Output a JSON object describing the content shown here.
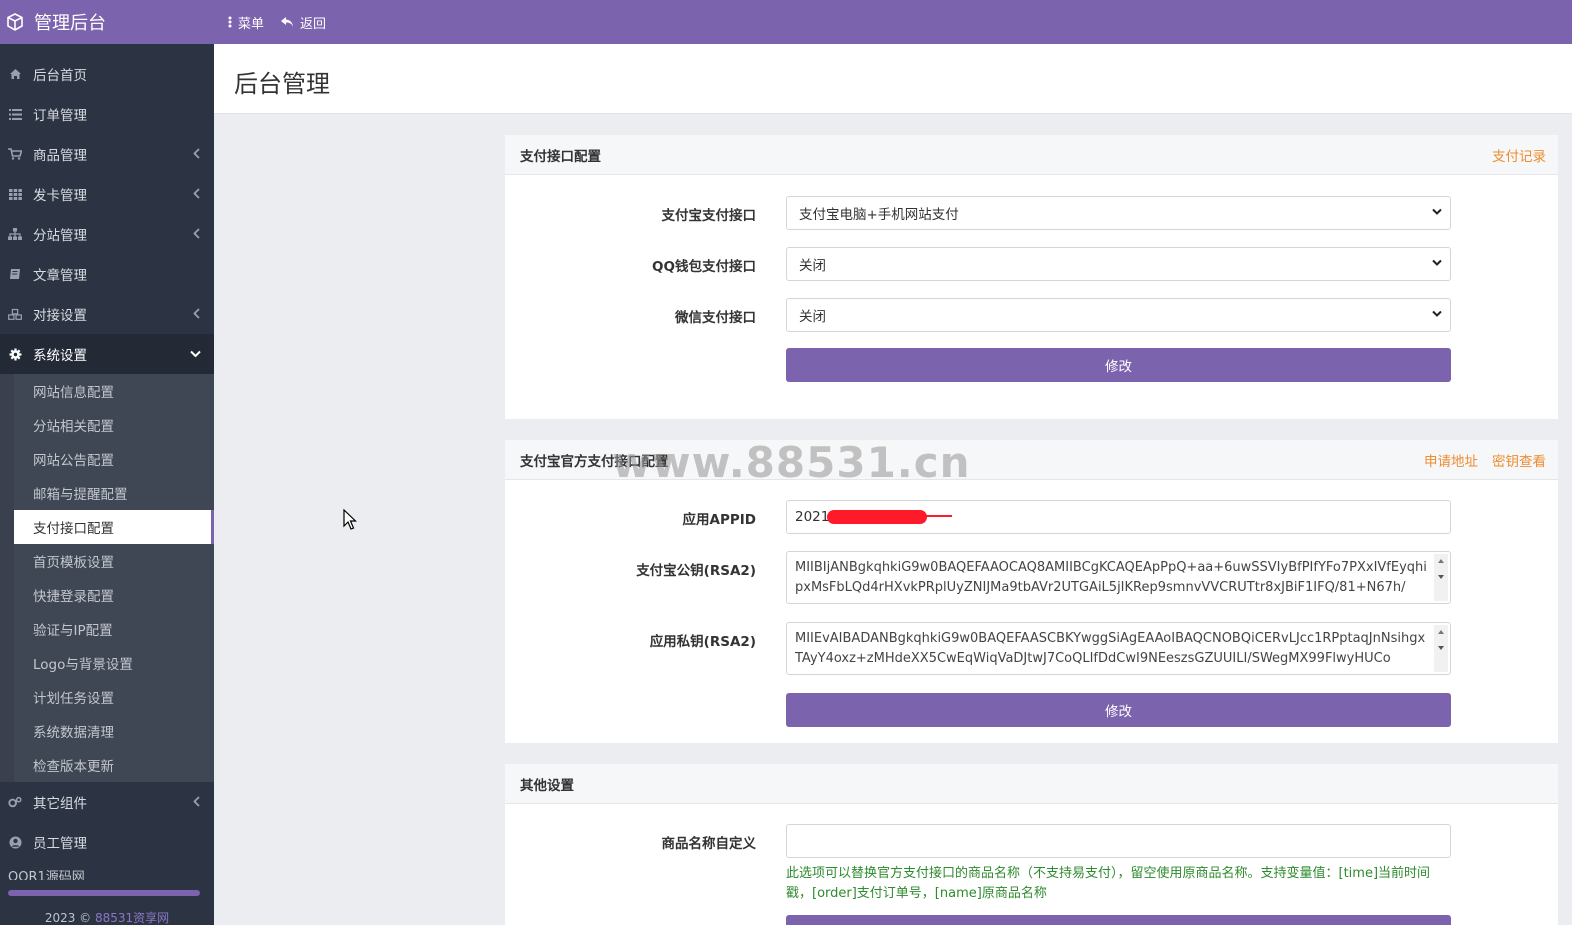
{
  "app": {
    "title": "管理后台"
  },
  "topnav": {
    "menu": "菜单",
    "back": "返回"
  },
  "sidebar": {
    "items": [
      {
        "label": "后台首页",
        "icon": "home-icon"
      },
      {
        "label": "订单管理",
        "icon": "list-icon"
      },
      {
        "label": "商品管理",
        "icon": "cart-icon",
        "has_children": true
      },
      {
        "label": "发卡管理",
        "icon": "grid-icon",
        "has_children": true
      },
      {
        "label": "分站管理",
        "icon": "sitemap-icon",
        "has_children": true
      },
      {
        "label": "文章管理",
        "icon": "book-icon"
      },
      {
        "label": "对接设置",
        "icon": "cubes-icon",
        "has_children": true
      },
      {
        "label": "系统设置",
        "icon": "gear-icon",
        "expanded": true
      }
    ],
    "sub_items": [
      "网站信息配置",
      "分站相关配置",
      "网站公告配置",
      "邮箱与提醒配置",
      "支付接口配置",
      "首页模板设置",
      "快捷登录配置",
      "验证与IP配置",
      "Logo与背景设置",
      "计划任务设置",
      "系统数据清理",
      "检查版本更新"
    ],
    "current_sub": "支付接口配置",
    "bottom_items": [
      {
        "label": "其它组件",
        "icon": "gears-icon",
        "has_children": true
      },
      {
        "label": "员工管理",
        "icon": "user-circle-icon"
      }
    ],
    "footer_partial": "QQR1源码网",
    "copyright_year": "2023 ©",
    "copyright_link": "88531资享网"
  },
  "page": {
    "title": "后台管理"
  },
  "panel_payment": {
    "title": "支付接口配置",
    "link": "支付记录",
    "fields": [
      {
        "label": "支付宝支付接口",
        "value": "支付宝电脑+手机网站支付"
      },
      {
        "label": "QQ钱包支付接口",
        "value": "关闭"
      },
      {
        "label": "微信支付接口",
        "value": "关闭"
      }
    ],
    "submit": "修改"
  },
  "panel_alipay": {
    "title": "支付宝官方支付接口配置",
    "links": [
      "申请地址",
      "密钥查看"
    ],
    "appid_label": "应用APPID",
    "appid_value": "2021",
    "pubkey_label": "支付宝公钥(RSA2)",
    "pubkey_value": "MIIBIjANBgkqhkiG9w0BAQEFAAOCAQ8AMIIBCgKCAQEApPpQ+aa+6uwSSVIyBfPIfYFo7PXxIVfEyqhipxMsFbLQd4rHXvkPRplUyZNIJMa9tbAVr2UTGAiL5jIKRep9smnvVVCRUTtr8xJBiF1IFQ/81+N67h/",
    "privkey_label": "应用私钥(RSA2)",
    "privkey_value": "MIIEvAIBADANBgkqhkiG9w0BAQEFAASCBKYwggSiAgEAAoIBAQCNOBQiCERvLJcc1RPptaqJnNsihgxTAyY4oxz+zMHdeXX5CwEqWiqVaDJtwJ7CoQLIfDdCwI9NEeszsGZUUILI/SWegMX99FlwyHUCo",
    "submit": "修改"
  },
  "panel_other": {
    "title": "其他设置",
    "name_label": "商品名称自定义",
    "name_value": "",
    "help": "此选项可以替换官方支付接口的商品名称（不支持易支付），留空使用原商品名称。支持变量值：[time]当前时间戳，[order]支付订单号，[name]原商品名称"
  },
  "watermark": "www.88531.cn",
  "colors": {
    "primary": "#7c63ad",
    "sidebar": "#2c3443",
    "link_orange": "#ef8c2e",
    "help_green": "#2e8b2e"
  }
}
